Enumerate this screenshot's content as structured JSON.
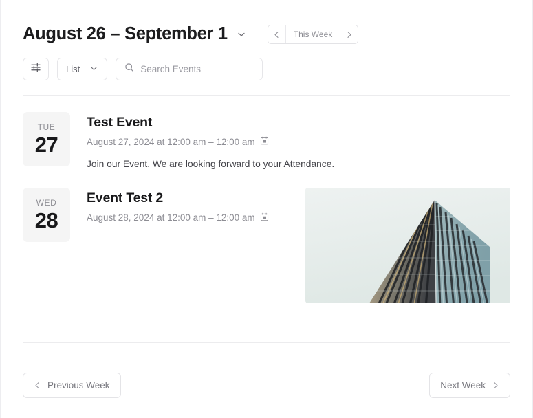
{
  "header": {
    "title": "August 26 – September 1",
    "title_caret_icon": "chevron-down-icon",
    "nav": {
      "prev_icon": "chevron-left-icon",
      "label": "This Week",
      "next_icon": "chevron-right-icon"
    }
  },
  "toolbar": {
    "filter_icon": "sliders-icon",
    "view_select": {
      "value": "List",
      "caret_icon": "chevron-down-icon"
    },
    "search": {
      "icon": "search-icon",
      "value": "",
      "placeholder": "Search Events"
    }
  },
  "events": [
    {
      "dow": "TUE",
      "day": "27",
      "title": "Test Event",
      "meta": "August 27, 2024 at 12:00 am – 12:00 am",
      "meta_icon": "calendar-icon",
      "description": "Join our Event. We are looking forward to your Attendance.",
      "has_image": false
    },
    {
      "dow": "WED",
      "day": "28",
      "title": "Event Test 2",
      "meta": "August 28, 2024 at 12:00 am – 12:00 am",
      "meta_icon": "calendar-icon",
      "description": "",
      "has_image": true,
      "image_alt": "skyscraper-photo"
    }
  ],
  "footer": {
    "previous": {
      "icon": "chevron-left-icon",
      "label": "Previous Week"
    },
    "next": {
      "label": "Next Week",
      "icon": "chevron-right-icon"
    }
  },
  "colors": {
    "text_primary": "#18181a",
    "text_muted": "#8d8d94",
    "border": "#e6e6e9",
    "badge_bg": "#f5f5f5",
    "divider": "#ececee"
  }
}
